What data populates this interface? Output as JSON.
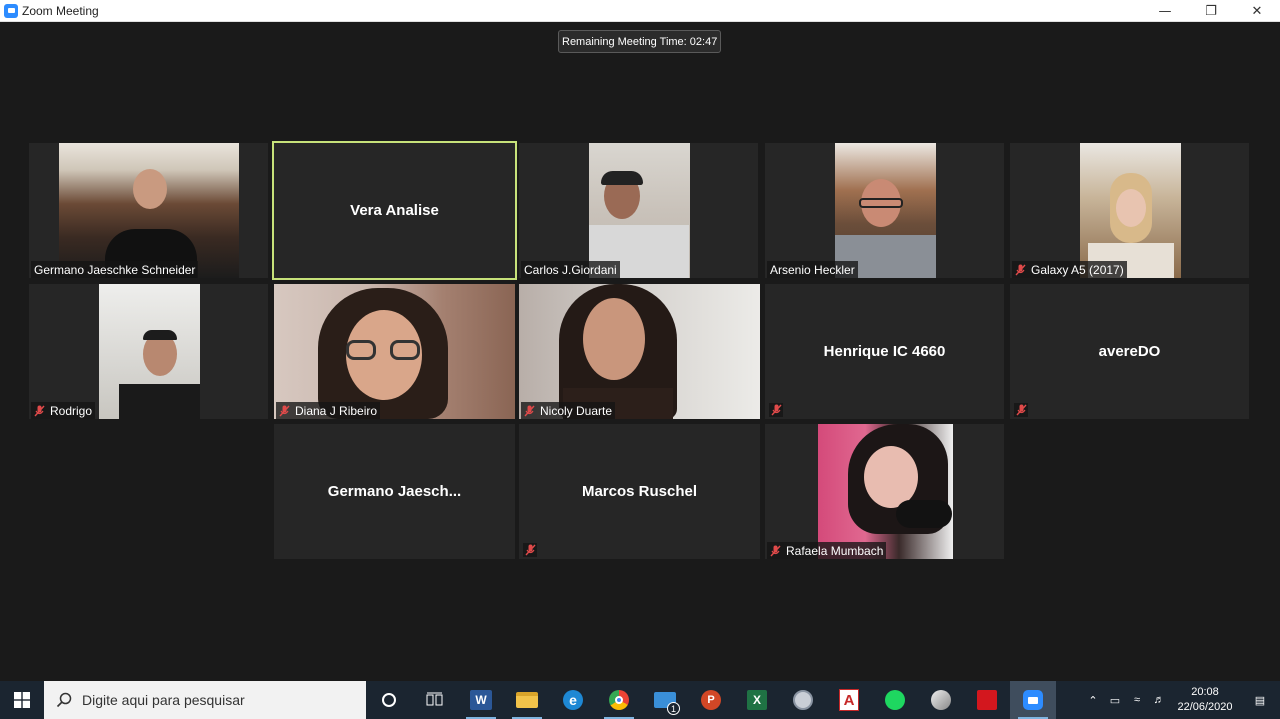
{
  "window": {
    "title": "Zoom Meeting",
    "minimize": "—",
    "restore": "❐",
    "close": "✕"
  },
  "timer": "Remaining Meeting Time: 02:47",
  "participants": {
    "p1": {
      "name": "Germano Jaeschke Schneider"
    },
    "p2": {
      "name": "Vera Analise"
    },
    "p3": {
      "name": "Carlos J.Giordani"
    },
    "p4": {
      "name": "Arsenio Heckler"
    },
    "p5": {
      "name": "Galaxy A5 (2017)"
    },
    "p6": {
      "name": "Rodrigo"
    },
    "p7": {
      "name": "Diana J Ribeiro"
    },
    "p8": {
      "name": "Nicoly Duarte"
    },
    "p9": {
      "name": "Henrique IC 4660"
    },
    "p10": {
      "name": "avereDO"
    },
    "p11": {
      "name": "Germano  Jaesch..."
    },
    "p12": {
      "name": "Marcos Ruschel"
    },
    "p13": {
      "name": "Rafaela Mumbach"
    }
  },
  "taskbar": {
    "search_placeholder": "Digite aqui para pesquisar",
    "mail_badge": "1",
    "time": "20:08",
    "date": "22/06/2020"
  },
  "colors": {
    "active_speaker": "#c7e27a",
    "muted": "#e04a4a",
    "taskbar": "#1b2530"
  }
}
